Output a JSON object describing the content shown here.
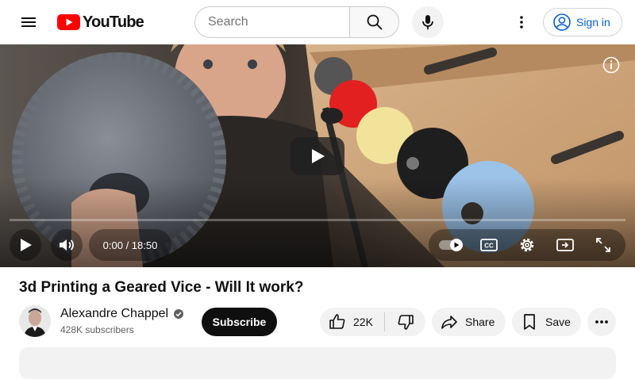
{
  "header": {
    "logo_text": "YouTube",
    "search_placeholder": "Search",
    "signin_label": "Sign in",
    "icons": [
      "menu-icon",
      "search-icon",
      "mic-icon",
      "more-vert-icon",
      "account-icon"
    ]
  },
  "player": {
    "time_display": "0:00 / 18:50",
    "progress_fraction": 0,
    "icons": [
      "info-icon",
      "play-icon",
      "volume-icon",
      "autoplay-toggle",
      "captions-icon",
      "settings-icon",
      "miniplayer-icon",
      "fullscreen-icon"
    ]
  },
  "video": {
    "title": "3d Printing a Geared Vice - Will It work?",
    "channel_name": "Alexandre Chappel",
    "subscribers": "428K subscribers",
    "subscribe_label": "Subscribe",
    "like_count": "22K",
    "share_label": "Share",
    "save_label": "Save"
  },
  "colors": {
    "brand_red": "#ff0000",
    "link_blue": "#065fd4",
    "chip_gray": "#f2f2f2",
    "text_dark": "#0f0f0f",
    "text_muted": "#606060"
  }
}
